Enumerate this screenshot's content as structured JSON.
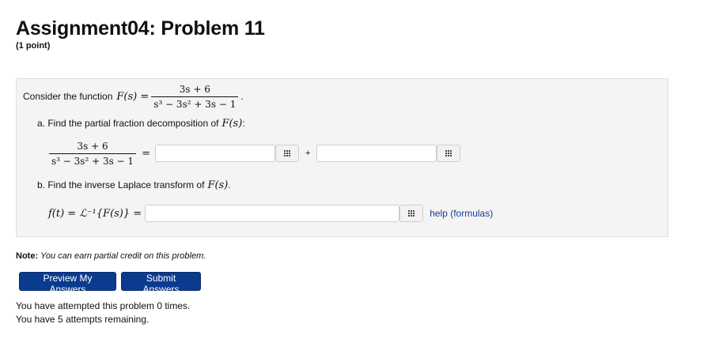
{
  "page": {
    "title": "Assignment04: Problem 11",
    "points": "(1 point)"
  },
  "problem": {
    "intro": "Consider the function",
    "F_lhs": "F(s) =",
    "numerator": "3s + 6",
    "denominator": "s³ − 3s² + 3s − 1",
    "period": ".",
    "part_a": "a. Find the partial fraction decomposition of",
    "part_a_var": "F(s)",
    "part_a_colon": ":",
    "equals": "=",
    "plus": "+",
    "part_b": "b. Find the inverse Laplace transform of",
    "part_b_var": "F(s)",
    "part_b_period": ".",
    "laplace_lhs": "f(t) = ℒ⁻¹{F(s)} =",
    "help_link": "help (formulas)",
    "answer1": "",
    "answer2": "",
    "answer3": ""
  },
  "note": {
    "label": "Note:",
    "text": "You can earn partial credit on this problem."
  },
  "buttons": {
    "preview": "Preview My Answers",
    "submit": "Submit Answers"
  },
  "status": {
    "attempted": "You have attempted this problem 0 times.",
    "remaining": "You have 5 attempts remaining."
  },
  "icons": {
    "equation_editor": "grid-keypad-icon"
  },
  "colors": {
    "button_bg": "#0b3b8f",
    "link": "#1a3e8c",
    "panel_bg": "#f4f4f4"
  }
}
